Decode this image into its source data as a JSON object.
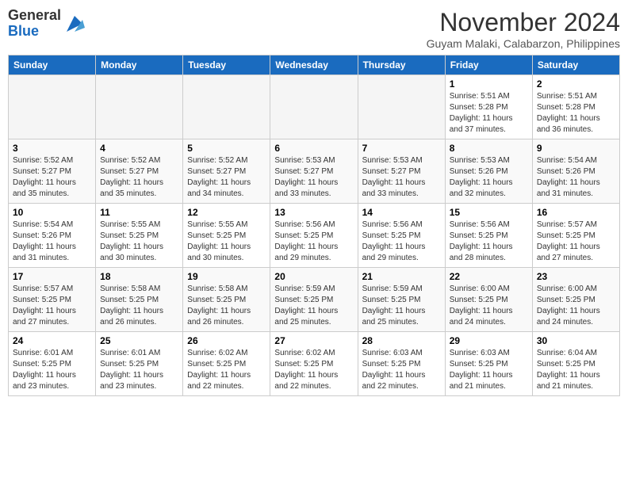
{
  "header": {
    "logo": {
      "general": "General",
      "blue": "Blue"
    },
    "title": "November 2024",
    "location": "Guyam Malaki, Calabarzon, Philippines"
  },
  "calendar": {
    "days_of_week": [
      "Sunday",
      "Monday",
      "Tuesday",
      "Wednesday",
      "Thursday",
      "Friday",
      "Saturday"
    ],
    "weeks": [
      [
        {
          "day": "",
          "empty": true
        },
        {
          "day": "",
          "empty": true
        },
        {
          "day": "",
          "empty": true
        },
        {
          "day": "",
          "empty": true
        },
        {
          "day": "",
          "empty": true
        },
        {
          "day": "1",
          "sunrise": "5:51 AM",
          "sunset": "5:28 PM",
          "daylight": "11 hours and 37 minutes."
        },
        {
          "day": "2",
          "sunrise": "5:51 AM",
          "sunset": "5:28 PM",
          "daylight": "11 hours and 36 minutes."
        }
      ],
      [
        {
          "day": "3",
          "sunrise": "5:52 AM",
          "sunset": "5:27 PM",
          "daylight": "11 hours and 35 minutes."
        },
        {
          "day": "4",
          "sunrise": "5:52 AM",
          "sunset": "5:27 PM",
          "daylight": "11 hours and 35 minutes."
        },
        {
          "day": "5",
          "sunrise": "5:52 AM",
          "sunset": "5:27 PM",
          "daylight": "11 hours and 34 minutes."
        },
        {
          "day": "6",
          "sunrise": "5:53 AM",
          "sunset": "5:27 PM",
          "daylight": "11 hours and 33 minutes."
        },
        {
          "day": "7",
          "sunrise": "5:53 AM",
          "sunset": "5:27 PM",
          "daylight": "11 hours and 33 minutes."
        },
        {
          "day": "8",
          "sunrise": "5:53 AM",
          "sunset": "5:26 PM",
          "daylight": "11 hours and 32 minutes."
        },
        {
          "day": "9",
          "sunrise": "5:54 AM",
          "sunset": "5:26 PM",
          "daylight": "11 hours and 31 minutes."
        }
      ],
      [
        {
          "day": "10",
          "sunrise": "5:54 AM",
          "sunset": "5:26 PM",
          "daylight": "11 hours and 31 minutes."
        },
        {
          "day": "11",
          "sunrise": "5:55 AM",
          "sunset": "5:25 PM",
          "daylight": "11 hours and 30 minutes."
        },
        {
          "day": "12",
          "sunrise": "5:55 AM",
          "sunset": "5:25 PM",
          "daylight": "11 hours and 30 minutes."
        },
        {
          "day": "13",
          "sunrise": "5:56 AM",
          "sunset": "5:25 PM",
          "daylight": "11 hours and 29 minutes."
        },
        {
          "day": "14",
          "sunrise": "5:56 AM",
          "sunset": "5:25 PM",
          "daylight": "11 hours and 29 minutes."
        },
        {
          "day": "15",
          "sunrise": "5:56 AM",
          "sunset": "5:25 PM",
          "daylight": "11 hours and 28 minutes."
        },
        {
          "day": "16",
          "sunrise": "5:57 AM",
          "sunset": "5:25 PM",
          "daylight": "11 hours and 27 minutes."
        }
      ],
      [
        {
          "day": "17",
          "sunrise": "5:57 AM",
          "sunset": "5:25 PM",
          "daylight": "11 hours and 27 minutes."
        },
        {
          "day": "18",
          "sunrise": "5:58 AM",
          "sunset": "5:25 PM",
          "daylight": "11 hours and 26 minutes."
        },
        {
          "day": "19",
          "sunrise": "5:58 AM",
          "sunset": "5:25 PM",
          "daylight": "11 hours and 26 minutes."
        },
        {
          "day": "20",
          "sunrise": "5:59 AM",
          "sunset": "5:25 PM",
          "daylight": "11 hours and 25 minutes."
        },
        {
          "day": "21",
          "sunrise": "5:59 AM",
          "sunset": "5:25 PM",
          "daylight": "11 hours and 25 minutes."
        },
        {
          "day": "22",
          "sunrise": "6:00 AM",
          "sunset": "5:25 PM",
          "daylight": "11 hours and 24 minutes."
        },
        {
          "day": "23",
          "sunrise": "6:00 AM",
          "sunset": "5:25 PM",
          "daylight": "11 hours and 24 minutes."
        }
      ],
      [
        {
          "day": "24",
          "sunrise": "6:01 AM",
          "sunset": "5:25 PM",
          "daylight": "11 hours and 23 minutes."
        },
        {
          "day": "25",
          "sunrise": "6:01 AM",
          "sunset": "5:25 PM",
          "daylight": "11 hours and 23 minutes."
        },
        {
          "day": "26",
          "sunrise": "6:02 AM",
          "sunset": "5:25 PM",
          "daylight": "11 hours and 22 minutes."
        },
        {
          "day": "27",
          "sunrise": "6:02 AM",
          "sunset": "5:25 PM",
          "daylight": "11 hours and 22 minutes."
        },
        {
          "day": "28",
          "sunrise": "6:03 AM",
          "sunset": "5:25 PM",
          "daylight": "11 hours and 22 minutes."
        },
        {
          "day": "29",
          "sunrise": "6:03 AM",
          "sunset": "5:25 PM",
          "daylight": "11 hours and 21 minutes."
        },
        {
          "day": "30",
          "sunrise": "6:04 AM",
          "sunset": "5:25 PM",
          "daylight": "11 hours and 21 minutes."
        }
      ]
    ]
  }
}
